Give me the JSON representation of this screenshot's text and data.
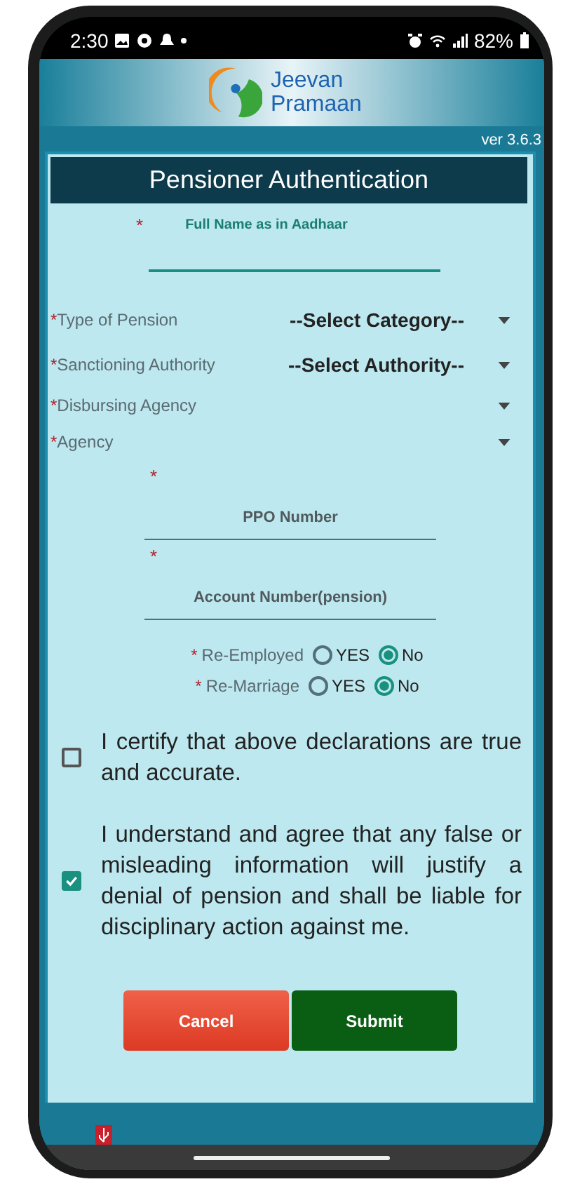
{
  "status_bar": {
    "time": "2:30",
    "battery": "82%"
  },
  "header": {
    "app_name": "Jeevan Pramaan",
    "version": "ver 3.6.3"
  },
  "form": {
    "title": "Pensioner Authentication",
    "name_field": {
      "asterisk": "*",
      "label": "Full Name as in Aadhaar"
    },
    "dropdowns": [
      {
        "asterisk": "*",
        "label": "Type of Pension",
        "value": "--Select Category--"
      },
      {
        "asterisk": "*",
        "label": "Sanctioning Authority",
        "value": "--Select Authority--"
      },
      {
        "asterisk": "*",
        "label": "Disbursing Agency"
      },
      {
        "asterisk": "*",
        "label": "Agency"
      }
    ],
    "number_fields": [
      {
        "asterisk": "*",
        "placeholder": "PPO Number"
      },
      {
        "asterisk": "*",
        "placeholder": "Account Number(pension)"
      }
    ],
    "radio_groups": [
      {
        "asterisk": "*",
        "label": "Re-Employed",
        "options": [
          {
            "label": "YES",
            "selected": false
          },
          {
            "label": "No",
            "selected": true
          }
        ]
      },
      {
        "asterisk": "*",
        "label": "Re-Marriage",
        "options": [
          {
            "label": "YES",
            "selected": false
          },
          {
            "label": "No",
            "selected": true
          }
        ]
      }
    ],
    "declarations": [
      {
        "text": "I certify that above declarations are true and accurate.",
        "checked": false
      },
      {
        "text": "I understand and agree that any false or misleading information will justify a denial of pension and shall be liable for disciplinary action against me.",
        "checked": true
      }
    ],
    "buttons": [
      {
        "label": "Cancel",
        "kind": "cancel"
      },
      {
        "label": "Submit",
        "kind": "submit"
      }
    ]
  }
}
